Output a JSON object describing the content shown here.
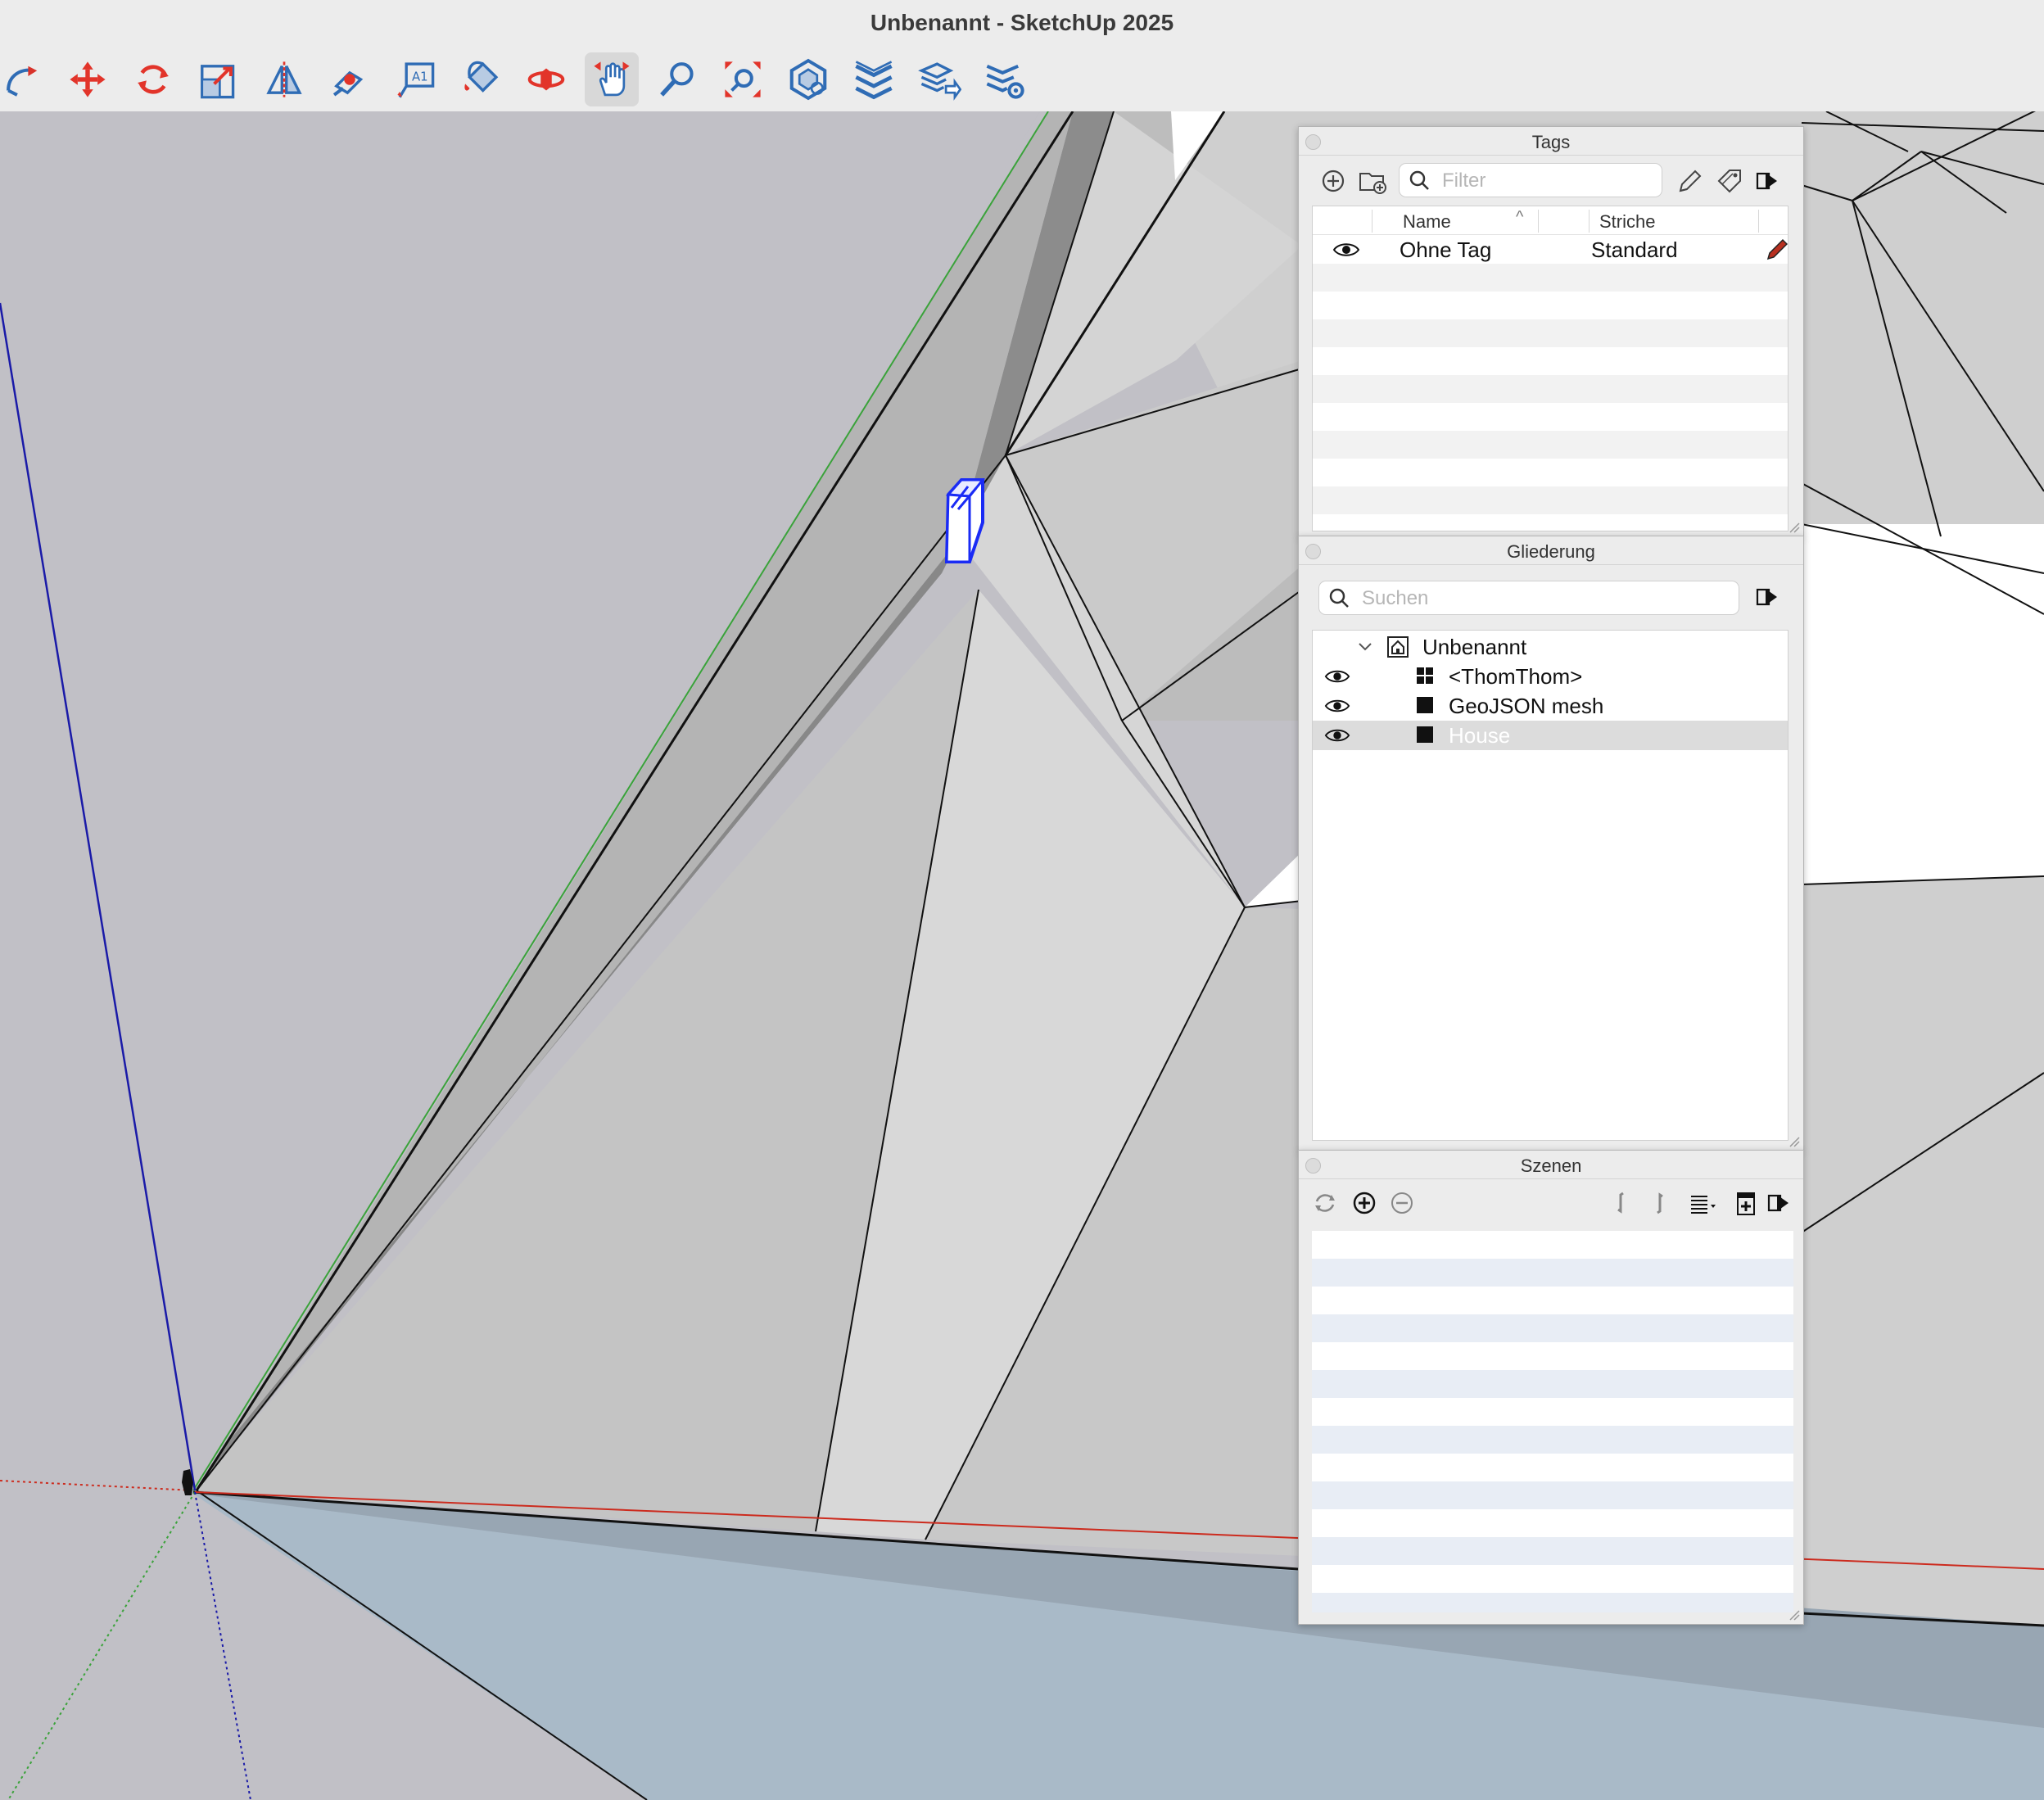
{
  "window": {
    "title": "Unbenannt - SketchUp 2025"
  },
  "toolbar": {
    "tools": [
      {
        "name": "follow-me-icon"
      },
      {
        "name": "move-icon"
      },
      {
        "name": "rotate-icon"
      },
      {
        "name": "scale-icon"
      },
      {
        "name": "flip-icon"
      },
      {
        "name": "position-texture-icon"
      },
      {
        "name": "text-icon"
      },
      {
        "name": "paint-bucket-icon"
      },
      {
        "name": "orbit-icon"
      },
      {
        "name": "pan-icon",
        "active": true
      },
      {
        "name": "zoom-icon"
      },
      {
        "name": "zoom-extents-icon"
      },
      {
        "name": "solid-inspector-icon"
      },
      {
        "name": "layers-stack-icon"
      },
      {
        "name": "layers-export-icon"
      },
      {
        "name": "layers-settings-icon"
      }
    ]
  },
  "tags_panel": {
    "title": "Tags",
    "filter_placeholder": "Filter",
    "col_name": "Name",
    "col_strokes": "Striche",
    "rows": [
      {
        "name": "Ohne Tag",
        "strokes": "Standard"
      }
    ]
  },
  "outline_panel": {
    "title": "Gliederung",
    "search_placeholder": "Suchen",
    "root": "Unbenannt",
    "items": [
      {
        "label": "<ThomThom>",
        "icon": "component-icon",
        "visible": true,
        "selected": false
      },
      {
        "label": "GeoJSON mesh",
        "icon": "group-icon",
        "visible": true,
        "selected": false
      },
      {
        "label": "House",
        "icon": "group-icon",
        "visible": true,
        "selected": true
      }
    ]
  },
  "scenes_panel": {
    "title": "Szenen"
  },
  "colors": {
    "red_axis": "#cc2b1e",
    "green_axis": "#3aa23a",
    "blue_axis": "#1a1aa8",
    "selection": "#1a2bf5",
    "ground": "#a9bac8"
  }
}
